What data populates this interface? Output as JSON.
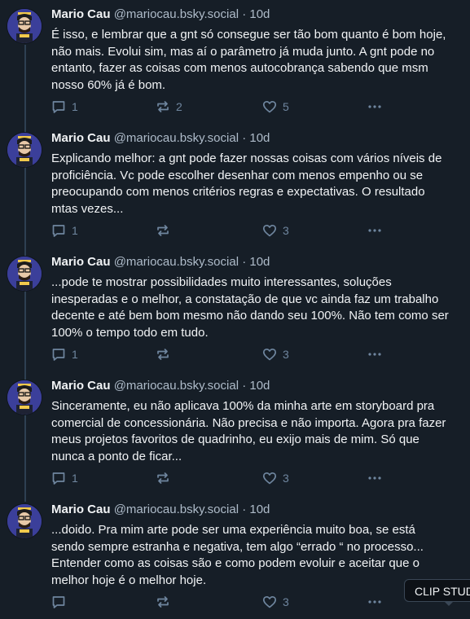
{
  "posts": [
    {
      "author_name": "Mario Cau",
      "handle": "@mariocau.bsky.social",
      "separator": "·",
      "time": "10d",
      "text": "É isso, e lembrar que a gnt só consegue ser tão bom quanto é bom hoje, não mais. Evolui sim, mas aí o parâmetro já muda junto. A gnt pode no entanto, fazer as coisas com menos autocobrança sabendo que msm nosso 60% já é bom.",
      "replies": "1",
      "reposts": "2",
      "likes": "5"
    },
    {
      "author_name": "Mario Cau",
      "handle": "@mariocau.bsky.social",
      "separator": "·",
      "time": "10d",
      "text": "Explicando melhor: a gnt pode fazer nossas coisas com vários níveis de proficiência. Vc pode escolher desenhar com menos empenho ou se preocupando com menos critérios regras e expectativas. O resultado mtas vezes...",
      "replies": "1",
      "reposts": "",
      "likes": "3"
    },
    {
      "author_name": "Mario Cau",
      "handle": "@mariocau.bsky.social",
      "separator": "·",
      "time": "10d",
      "text": "...pode te mostrar possibilidades muito interessantes, soluções inesperadas e o melhor, a constatação de que vc ainda faz um trabalho decente e até bem bom mesmo não dando seu 100%. Não tem como ser 100% o tempo todo em tudo.",
      "replies": "1",
      "reposts": "",
      "likes": "3"
    },
    {
      "author_name": "Mario Cau",
      "handle": "@mariocau.bsky.social",
      "separator": "·",
      "time": "10d",
      "text": "Sinceramente, eu não aplicava 100% da minha arte em storyboard pra comercial de concessionária. Não precisa e não importa. Agora pra fazer meus projetos favoritos de quadrinho, eu exijo mais de mim. Só que nunca a ponto de ficar...",
      "replies": "1",
      "reposts": "",
      "likes": "3"
    },
    {
      "author_name": "Mario Cau",
      "handle": "@mariocau.bsky.social",
      "separator": "·",
      "time": "10d",
      "text": "...doido. Pra mim arte pode ser uma experiência muito boa, se está sendo sempre estranha e negativa, tem algo “errado “ no processo... Entender como as coisas são e como podem evoluir e aceitar que o melhor hoje é o melhor hoje.",
      "replies": "",
      "reposts": "",
      "likes": "3"
    }
  ],
  "tooltip": {
    "text": "CLIP STUDIO"
  },
  "icons": {
    "reply": "speech-bubble-icon",
    "repost": "repost-arrows-icon",
    "like": "heart-icon",
    "more": "ellipsis-icon"
  },
  "colors": {
    "background": "#161e27",
    "text": "#f1f3f5",
    "muted": "#aebbc9",
    "action": "#6f869f",
    "thread_line": "#2e4052",
    "avatar_bg": "#3b3f9a"
  }
}
